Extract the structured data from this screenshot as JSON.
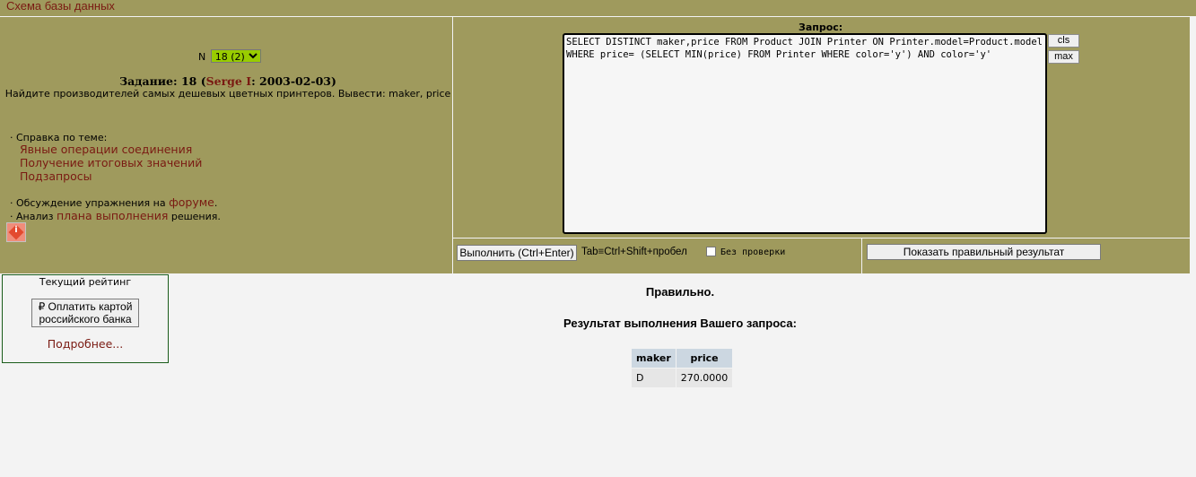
{
  "top": {
    "schema_link": "Схема базы данных"
  },
  "task": {
    "n_label": "N",
    "n_selected": "18 (2)",
    "title_prefix": "Задание: 18 (",
    "author": "Serge I",
    "title_suffix": ": 2003-02-03)",
    "text": "Найдите производителей самых дешевых цветных принтеров. Вывести: maker, price"
  },
  "help": {
    "label": "· Справка по теме:",
    "links": [
      "Явные операции соединения",
      "Получение итоговых значений",
      "Подзапросы"
    ],
    "forum_prefix": "· Обсуждение упражнения на ",
    "forum_link": "форуме",
    "forum_suffix": ".",
    "plan_prefix": "· Анализ ",
    "plan_link": "плана выполнения",
    "plan_suffix": " решения.",
    "info_icon_letter": "i"
  },
  "query": {
    "label": "Запрос:",
    "sql": "SELECT DISTINCT maker,price FROM Product JOIN Printer ON Printer.model=Product.model WHERE price= (SELECT MIN(price) FROM Printer WHERE color='y') AND color='y'",
    "cls_label": "cls",
    "max_label": "max"
  },
  "actions": {
    "execute_label": "Выполнить (Ctrl+Enter)",
    "tab_hint": "Tab≡Ctrl+Shift+пробел",
    "noverify_label": "Без проверки",
    "show_correct_label": "Показать правильный результат"
  },
  "rating": {
    "title": "Текущий рейтинг",
    "pay_button": "₽ Оплатить картой российского банка",
    "more_link": "Подробнее..."
  },
  "result": {
    "status": "Правильно.",
    "title": "Результат выполнения Вашего запроса:",
    "columns": [
      "maker",
      "price"
    ],
    "rows": [
      [
        "D",
        "270.0000"
      ]
    ]
  },
  "colors": {
    "panel": "#9f9a5d",
    "link": "#7a1a12",
    "select_bg": "#99cc00"
  }
}
